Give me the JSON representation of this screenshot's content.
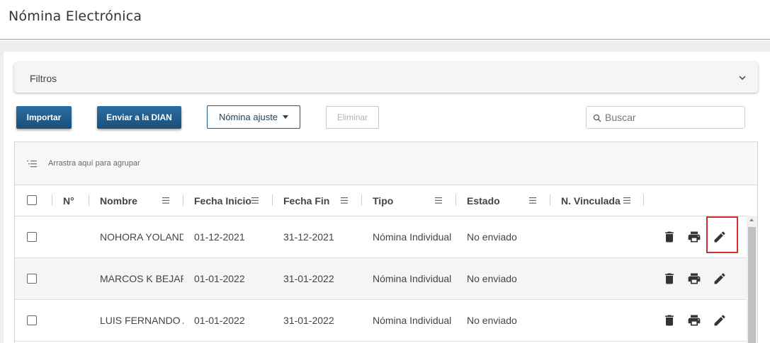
{
  "page": {
    "title": "Nómina Electrónica"
  },
  "filters": {
    "label": "Filtros"
  },
  "toolbar": {
    "import_label": "Importar",
    "send_dian_label": "Enviar a la DIAN",
    "adjustment_label": "Nómina ajuste",
    "delete_label": "Eliminar",
    "search_placeholder": "Buscar"
  },
  "grid": {
    "group_hint": "Arrastra aquí para agrupar",
    "columns": {
      "number": "N°",
      "name": "Nombre",
      "start_date": "Fecha Inicio",
      "end_date": "Fecha Fin",
      "type": "Tipo",
      "status": "Estado",
      "linked": "N. Vinculada"
    },
    "rows": [
      {
        "name": "NOHORA YOLANDA",
        "start_date": "01-12-2021",
        "end_date": "31-12-2021",
        "type": "Nómina Individual",
        "status": "No enviado"
      },
      {
        "name": "MARCOS K BEJARANO",
        "start_date": "01-01-2022",
        "end_date": "31-01-2022",
        "type": "Nómina Individual",
        "status": "No enviado"
      },
      {
        "name": "LUIS FERNANDO AR",
        "start_date": "01-01-2022",
        "end_date": "31-01-2022",
        "type": "Nómina Individual",
        "status": "No enviado"
      }
    ]
  },
  "icons": {
    "delete": "trash-icon",
    "print": "printer-icon",
    "edit": "pencil-icon"
  },
  "colors": {
    "primary": "#1b4f79",
    "highlight": "#d32f2f"
  }
}
